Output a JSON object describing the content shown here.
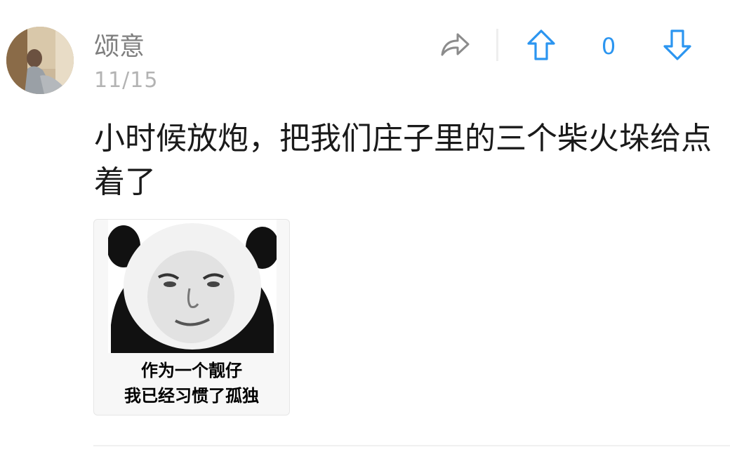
{
  "comment": {
    "user": {
      "name": "颂意",
      "avatar_icon": "user-avatar-photo"
    },
    "date": "11/15",
    "actions": {
      "share_icon": "share-arrow-icon",
      "upvote_icon": "up-arrow-icon",
      "downvote_icon": "down-arrow-icon",
      "vote_count": "0",
      "accent_color": "#2b95f0"
    },
    "text": "小时候放炮，把我们庄子里的三个柴火垛给点着了",
    "image": {
      "caption_line1": "作为一个靓仔",
      "caption_line2": "我已经习惯了孤独"
    }
  }
}
